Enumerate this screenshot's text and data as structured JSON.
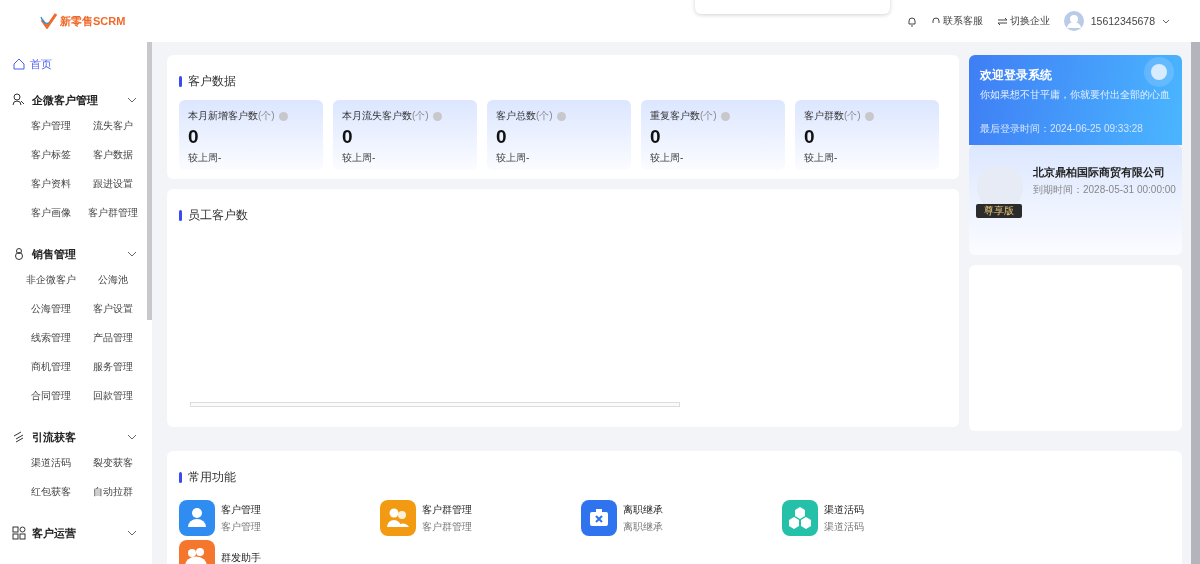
{
  "header": {
    "logo_text": "新零售SCRM",
    "contact": "联系客服",
    "switch": "切换企业",
    "user": "15612345678"
  },
  "sidebar": {
    "items": [
      {
        "kind": "link",
        "label": "首页",
        "selected": true
      },
      {
        "kind": "group",
        "label": "企微客户管理",
        "expanded": true,
        "children": [
          {
            "label": "客户管理",
            "selected": false
          },
          {
            "label": "流失客户",
            "selected": false
          },
          {
            "label": "客户标签",
            "selected": false
          },
          {
            "label": "客户数据",
            "selected": false
          },
          {
            "label": "客户资料",
            "selected": false
          },
          {
            "label": "跟进设置",
            "selected": false
          },
          {
            "label": "客户画像",
            "selected": false
          },
          {
            "label": "客户群管理",
            "selected": false
          }
        ]
      },
      {
        "kind": "group",
        "label": "销售管理",
        "expanded": true,
        "children": [
          {
            "label": "非企微客户",
            "selected": false
          },
          {
            "label": "公海池",
            "selected": false
          },
          {
            "label": "公海管理",
            "selected": false
          },
          {
            "label": "客户设置",
            "selected": false
          },
          {
            "label": "线索管理",
            "selected": false
          },
          {
            "label": "产品管理",
            "selected": false
          },
          {
            "label": "商机管理",
            "selected": false
          },
          {
            "label": "服务管理",
            "selected": false
          },
          {
            "label": "合同管理",
            "selected": false
          },
          {
            "label": "回款管理",
            "selected": false
          }
        ]
      },
      {
        "kind": "group",
        "label": "引流获客",
        "expanded": true,
        "children": [
          {
            "label": "渠道活码",
            "selected": false
          },
          {
            "label": "裂变获客",
            "selected": false
          },
          {
            "label": "红包获客",
            "selected": false
          },
          {
            "label": "自动拉群",
            "selected": false
          }
        ]
      },
      {
        "kind": "group",
        "label": "客户运营",
        "expanded": true
      }
    ]
  },
  "customer_data": {
    "title": "客户数据",
    "stats": [
      {
        "label": "本月新增客户数",
        "unit": "(个)",
        "value": "0",
        "compare": "较上周-"
      },
      {
        "label": "本月流失客户数",
        "unit": "(个)",
        "value": "0",
        "compare": "较上周-"
      },
      {
        "label": "客户总数",
        "unit": "(个)",
        "value": "0",
        "compare": "较上周-"
      },
      {
        "label": "重复客户数",
        "unit": "(个)",
        "value": "0",
        "compare": "较上周-"
      },
      {
        "label": "客户群数",
        "unit": "(个)",
        "value": "0",
        "compare": "较上周-"
      }
    ]
  },
  "employee_customers": {
    "title": "员工客户数"
  },
  "welcome": {
    "title": "欢迎登录系统",
    "subtitle": "你如果想不甘平庸，你就要付出全部的心血",
    "last_login": "最后登录时间：2024-06-25 09:33:28"
  },
  "company": {
    "name": "北京鼎柏国际商贸有限公司",
    "expiry": "到期时间：2028-05-31 00:00:00",
    "edition": "尊享版"
  },
  "common_functions": {
    "title": "常用功能",
    "items": [
      {
        "kind": "customer",
        "label": "客户管理",
        "sublabel": "客户管理",
        "color": "#2f8cf0"
      },
      {
        "kind": "group",
        "label": "客户群管理",
        "sublabel": "客户群管理",
        "color": "#f29a12"
      },
      {
        "kind": "resign",
        "label": "离职继承",
        "sublabel": "离职继承",
        "color": "#2f73ee"
      },
      {
        "kind": "channel",
        "label": "渠道活码",
        "sublabel": "渠道活码",
        "color": "#25c0a8"
      },
      {
        "kind": "mass",
        "label": "群发助手",
        "color": "#f5772e"
      }
    ]
  }
}
